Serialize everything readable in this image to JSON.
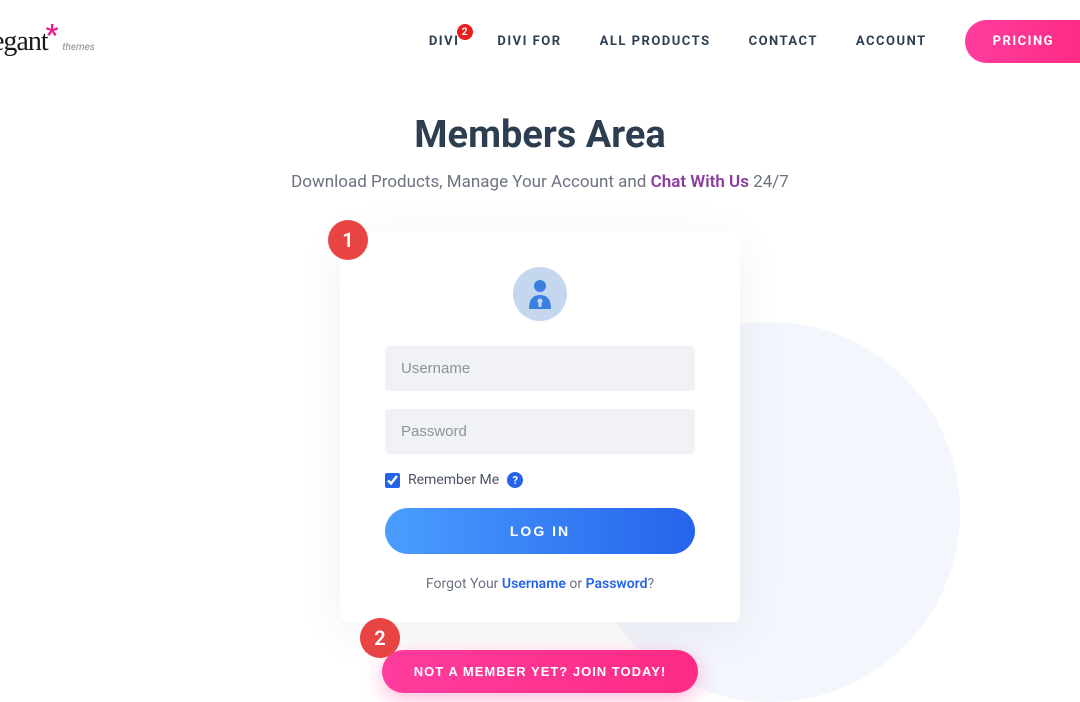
{
  "logo": {
    "text": "egant",
    "sub": "themes"
  },
  "nav": {
    "items": [
      {
        "label": "DIVI",
        "badge": "2"
      },
      {
        "label": "DIVI FOR"
      },
      {
        "label": "ALL PRODUCTS"
      },
      {
        "label": "CONTACT"
      },
      {
        "label": "ACCOUNT"
      }
    ],
    "pricing": "PRICING"
  },
  "main": {
    "title": "Members Area",
    "subtitle_pre": "Download Products, Manage Your Account and ",
    "subtitle_chat": "Chat With Us",
    "subtitle_post": " 24/7"
  },
  "steps": {
    "one": "1",
    "two": "2"
  },
  "form": {
    "username_placeholder": "Username",
    "password_placeholder": "Password",
    "remember_label": "Remember Me",
    "help_icon": "?",
    "login_btn": "LOG IN",
    "forgot_pre": "Forgot Your ",
    "forgot_username": "Username",
    "forgot_mid": " or ",
    "forgot_password": "Password",
    "forgot_post": "?"
  },
  "cta": {
    "join_btn": "NOT A MEMBER YET? JOIN TODAY!"
  }
}
